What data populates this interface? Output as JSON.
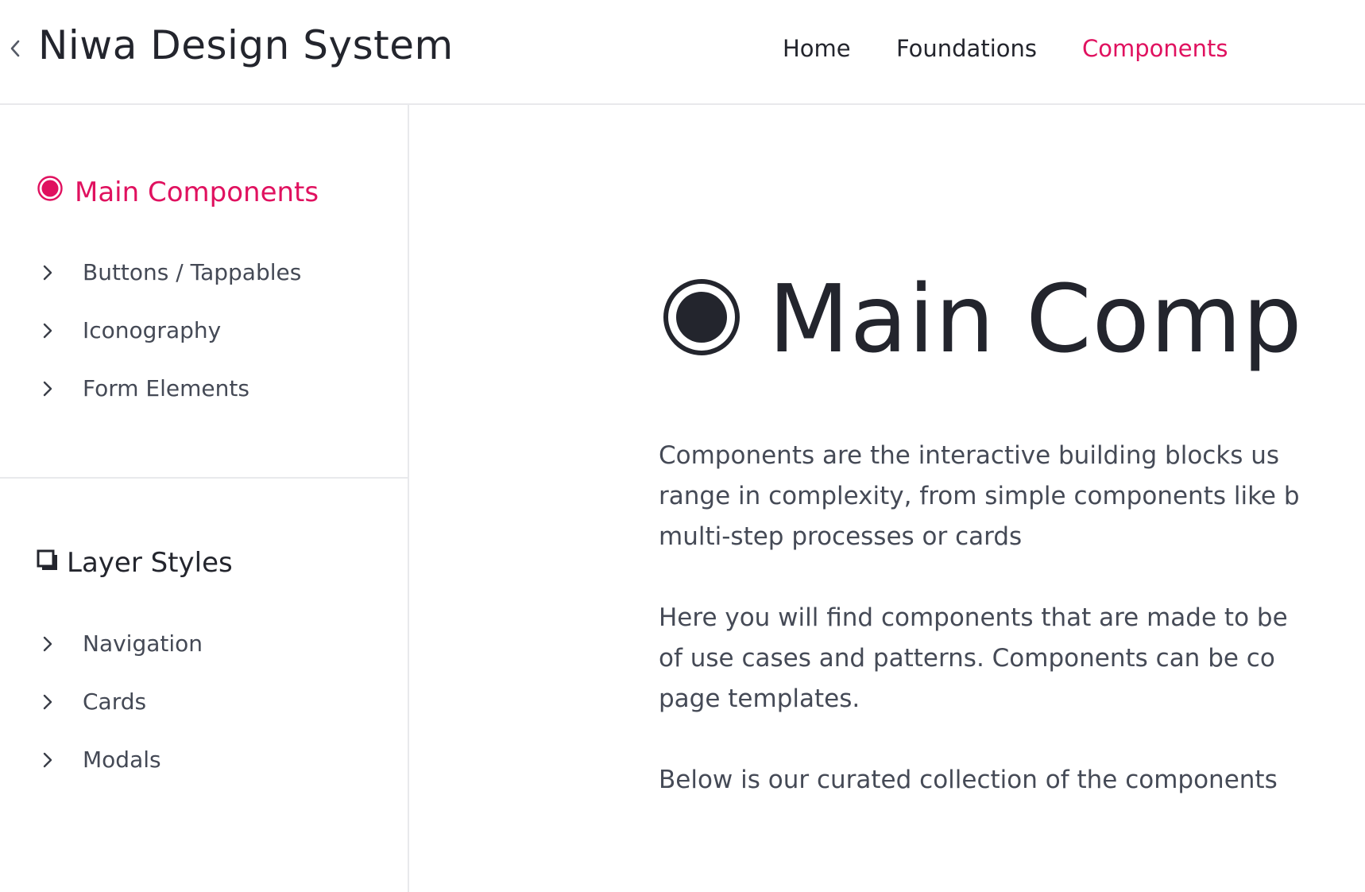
{
  "header": {
    "site_title": "Niwa Design System",
    "nav": [
      {
        "label": "Home",
        "active": false
      },
      {
        "label": "Foundations",
        "active": false
      },
      {
        "label": "Components",
        "active": true
      }
    ]
  },
  "sidebar": {
    "sections": [
      {
        "title": "Main Components",
        "icon": "radio-target-icon",
        "active": true,
        "items": [
          {
            "label": "Buttons / Tappables"
          },
          {
            "label": "Iconography"
          },
          {
            "label": "Form Elements"
          }
        ]
      },
      {
        "title": "Layer Styles",
        "icon": "layers-square-icon",
        "active": false,
        "items": [
          {
            "label": "Navigation"
          },
          {
            "label": "Cards"
          },
          {
            "label": "Modals"
          }
        ]
      }
    ]
  },
  "main": {
    "heading": "Main Comp",
    "paragraphs": [
      [
        "Components are the interactive building blocks us",
        "range in complexity, from simple components like b",
        "multi-step processes or cards"
      ],
      [
        "Here you will find components that are made to be",
        "of use cases and patterns. Components can be co",
        "page templates."
      ],
      [
        "Below is our curated collection of the components"
      ]
    ]
  },
  "colors": {
    "accent": "#e0115f",
    "text_dark": "#23252d",
    "text_body": "#454a56",
    "divider": "#e8e9ec"
  }
}
